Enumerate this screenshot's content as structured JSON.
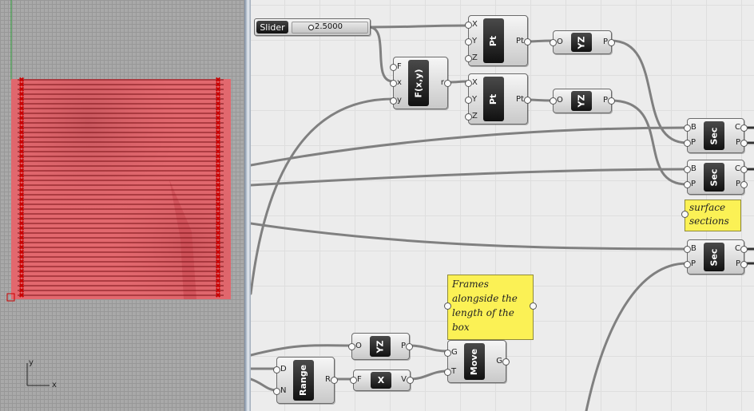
{
  "viewport": {
    "axis_y": "y",
    "axis_x": "x"
  },
  "canvas": {
    "slider": {
      "label": "Slider",
      "value": "2.5000"
    },
    "pt1": {
      "name": "Pt",
      "inputs": [
        "X",
        "Y",
        "Z"
      ],
      "output": "Pt"
    },
    "pt2": {
      "name": "Pt",
      "inputs": [
        "X",
        "Y",
        "Z"
      ],
      "output": "Pt"
    },
    "fxy": {
      "name": "F(x,y)",
      "inputs": [
        "F",
        "x",
        "y"
      ],
      "output": "r"
    },
    "yz1": {
      "name": "YZ",
      "input": "O",
      "output": "P"
    },
    "yz2": {
      "name": "YZ",
      "input": "O",
      "output": "P"
    },
    "yz3": {
      "name": "YZ",
      "input": "O",
      "output": "P"
    },
    "sec1": {
      "name": "Sec",
      "inputs": [
        "B",
        "P"
      ],
      "outputs": [
        "C",
        "P"
      ]
    },
    "sec2": {
      "name": "Sec",
      "inputs": [
        "B",
        "P"
      ],
      "outputs": [
        "C",
        "P"
      ]
    },
    "sec3": {
      "name": "Sec",
      "inputs": [
        "B",
        "P"
      ],
      "outputs": [
        "C",
        "P"
      ]
    },
    "note_sections": {
      "lines": [
        "surface",
        "sections"
      ]
    },
    "note_frames": {
      "lines": [
        "Frames",
        "alongside the",
        "length of the",
        "box"
      ]
    },
    "range": {
      "name": "Range",
      "inputs": [
        "D",
        "N"
      ],
      "output": "R"
    },
    "xvec": {
      "name": "X",
      "input": "F",
      "output": "V"
    },
    "move": {
      "name": "Move",
      "inputs": [
        "G",
        "T"
      ],
      "output": "G"
    }
  },
  "colors": {
    "surface": "#e0666c",
    "note": "#fbf155",
    "wire": "#808080"
  }
}
